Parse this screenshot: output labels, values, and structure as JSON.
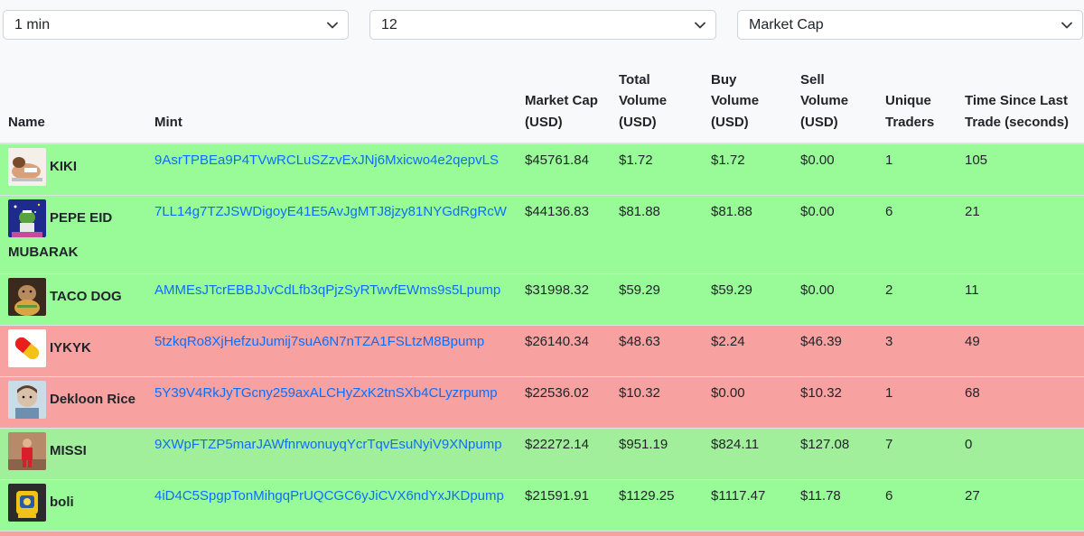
{
  "filters": {
    "interval": "1 min",
    "count": "12",
    "sort": "Market Cap"
  },
  "columns": {
    "name": "Name",
    "mint": "Mint",
    "market_cap_1": "Market Cap",
    "market_cap_2": "(USD)",
    "total_volume_1": "Total",
    "total_volume_2": "Volume",
    "total_volume_3": "(USD)",
    "buy_volume_1": "Buy",
    "buy_volume_2": "Volume",
    "buy_volume_3": "(USD)",
    "sell_volume_1": "Sell",
    "sell_volume_2": "Volume",
    "sell_volume_3": "(USD)",
    "unique_traders_1": "Unique",
    "unique_traders_2": "Traders",
    "time_since_1": "Time Since Last",
    "time_since_2": "Trade (seconds)"
  },
  "colors": {
    "positive_row": "#98fb98",
    "negative_row": "#f7a1a1",
    "link": "#0d6efd"
  },
  "rows": [
    {
      "name": "KIKI",
      "mint": "9AsrTPBEa9P4TVwRCLuSZzvExJNj6Mxicwo4e2qepvLS",
      "market_cap": "$45761.84",
      "total_volume": "$1.72",
      "buy_volume": "$1.72",
      "sell_volume": "$0.00",
      "unique_traders": "1",
      "time_since": "105",
      "status": "positive",
      "avatar": "kiki-avatar"
    },
    {
      "name": "PEPE EID MUBARAK",
      "mint": "7LL14g7TZJSWDigoyE41E5AvJgMTJ8jzy81NYGdRgRcW",
      "market_cap": "$44136.83",
      "total_volume": "$81.88",
      "buy_volume": "$81.88",
      "sell_volume": "$0.00",
      "unique_traders": "6",
      "time_since": "21",
      "status": "positive",
      "avatar": "pepe-avatar"
    },
    {
      "name": "TACO DOG",
      "mint": "AMMEsJTcrEBBJJvCdLfb3qPjzSyRTwvfEWms9s5Lpump",
      "market_cap": "$31998.32",
      "total_volume": "$59.29",
      "buy_volume": "$59.29",
      "sell_volume": "$0.00",
      "unique_traders": "2",
      "time_since": "11",
      "status": "positive",
      "avatar": "taco-dog-avatar"
    },
    {
      "name": "IYKYK",
      "mint": "5tzkqRo8XjHefzuJumij7suA6N7nTZA1FSLtzM8Bpump",
      "market_cap": "$26140.34",
      "total_volume": "$48.63",
      "buy_volume": "$2.24",
      "sell_volume": "$46.39",
      "unique_traders": "3",
      "time_since": "49",
      "status": "negative",
      "avatar": "pill-avatar"
    },
    {
      "name": "Dekloon Rice",
      "mint": "5Y39V4RkJyTGcny259axALCHyZxK2tnSXb4CLyzrpump",
      "market_cap": "$22536.02",
      "total_volume": "$10.32",
      "buy_volume": "$0.00",
      "sell_volume": "$10.32",
      "unique_traders": "1",
      "time_since": "68",
      "status": "negative",
      "avatar": "dekloon-avatar"
    },
    {
      "name": "MISSI",
      "mint": "9XWpFTZP5marJAWfnrwonuyqYcrTqvEsuNyiV9XNpump",
      "market_cap": "$22272.14",
      "total_volume": "$951.19",
      "buy_volume": "$824.11",
      "sell_volume": "$127.08",
      "unique_traders": "7",
      "time_since": "0",
      "status": "positive",
      "avatar": "missi-avatar"
    },
    {
      "name": "boli",
      "mint": "4iD4C5SpgpTonMihgqPrUQCGC6yJiCVX6ndYxJKDpump",
      "market_cap": "$21591.91",
      "total_volume": "$1129.25",
      "buy_volume": "$1117.47",
      "sell_volume": "$11.78",
      "unique_traders": "6",
      "time_since": "27",
      "status": "positive",
      "avatar": "boli-avatar"
    }
  ]
}
